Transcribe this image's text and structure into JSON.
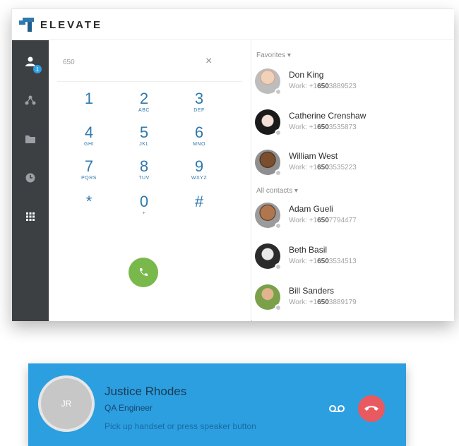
{
  "app": {
    "brand": "ELEVATE"
  },
  "sidebar": {
    "items": [
      {
        "name": "contacts-nav",
        "icon": "person-icon",
        "badge": "1"
      },
      {
        "name": "groups-nav",
        "icon": "network-icon"
      },
      {
        "name": "files-nav",
        "icon": "folder-icon"
      },
      {
        "name": "history-nav",
        "icon": "clock-icon"
      },
      {
        "name": "dialpad-nav",
        "icon": "dialpad-icon"
      }
    ]
  },
  "dialer": {
    "input_value": "650",
    "keys": [
      {
        "num": "1",
        "letters": ""
      },
      {
        "num": "2",
        "letters": "ABC"
      },
      {
        "num": "3",
        "letters": "DEF"
      },
      {
        "num": "4",
        "letters": "GHI"
      },
      {
        "num": "5",
        "letters": "JKL"
      },
      {
        "num": "6",
        "letters": "MNO"
      },
      {
        "num": "7",
        "letters": "PQRS"
      },
      {
        "num": "8",
        "letters": "TUV"
      },
      {
        "num": "9",
        "letters": "WXYZ"
      },
      {
        "num": "*",
        "letters": ""
      },
      {
        "num": "0",
        "letters": "+"
      },
      {
        "num": "#",
        "letters": ""
      }
    ]
  },
  "contacts": {
    "favorites_label": "Favorites",
    "all_label": "All contacts",
    "favorites": [
      {
        "name": "Don King",
        "work_prefix": "Work: +1",
        "work_match": "650",
        "work_rest": "3889523"
      },
      {
        "name": "Catherine Crenshaw",
        "work_prefix": "Work: +1",
        "work_match": "650",
        "work_rest": "3535873"
      },
      {
        "name": "William West",
        "work_prefix": "Work: +1",
        "work_match": "650",
        "work_rest": "3535223"
      }
    ],
    "all": [
      {
        "name": "Adam Gueli",
        "work_prefix": "Work: +1",
        "work_match": "650",
        "work_rest": "7794477"
      },
      {
        "name": "Beth Basil",
        "work_prefix": "Work: +1",
        "work_match": "650",
        "work_rest": "3534513"
      },
      {
        "name": "Bill Sanders",
        "work_prefix": "Work: +1",
        "work_match": "650",
        "work_rest": "3889179"
      }
    ]
  },
  "incoming_call": {
    "initials": "JR",
    "name": "Justice Rhodes",
    "title": "QA Engineer",
    "instruction": "Pick up handset or press speaker button"
  },
  "colors": {
    "brand": "#2f79ad",
    "sidebar": "#3c4043",
    "call_green": "#79b84a",
    "call_bar": "#2c9fe0",
    "hangup_red": "#e85a5f"
  }
}
